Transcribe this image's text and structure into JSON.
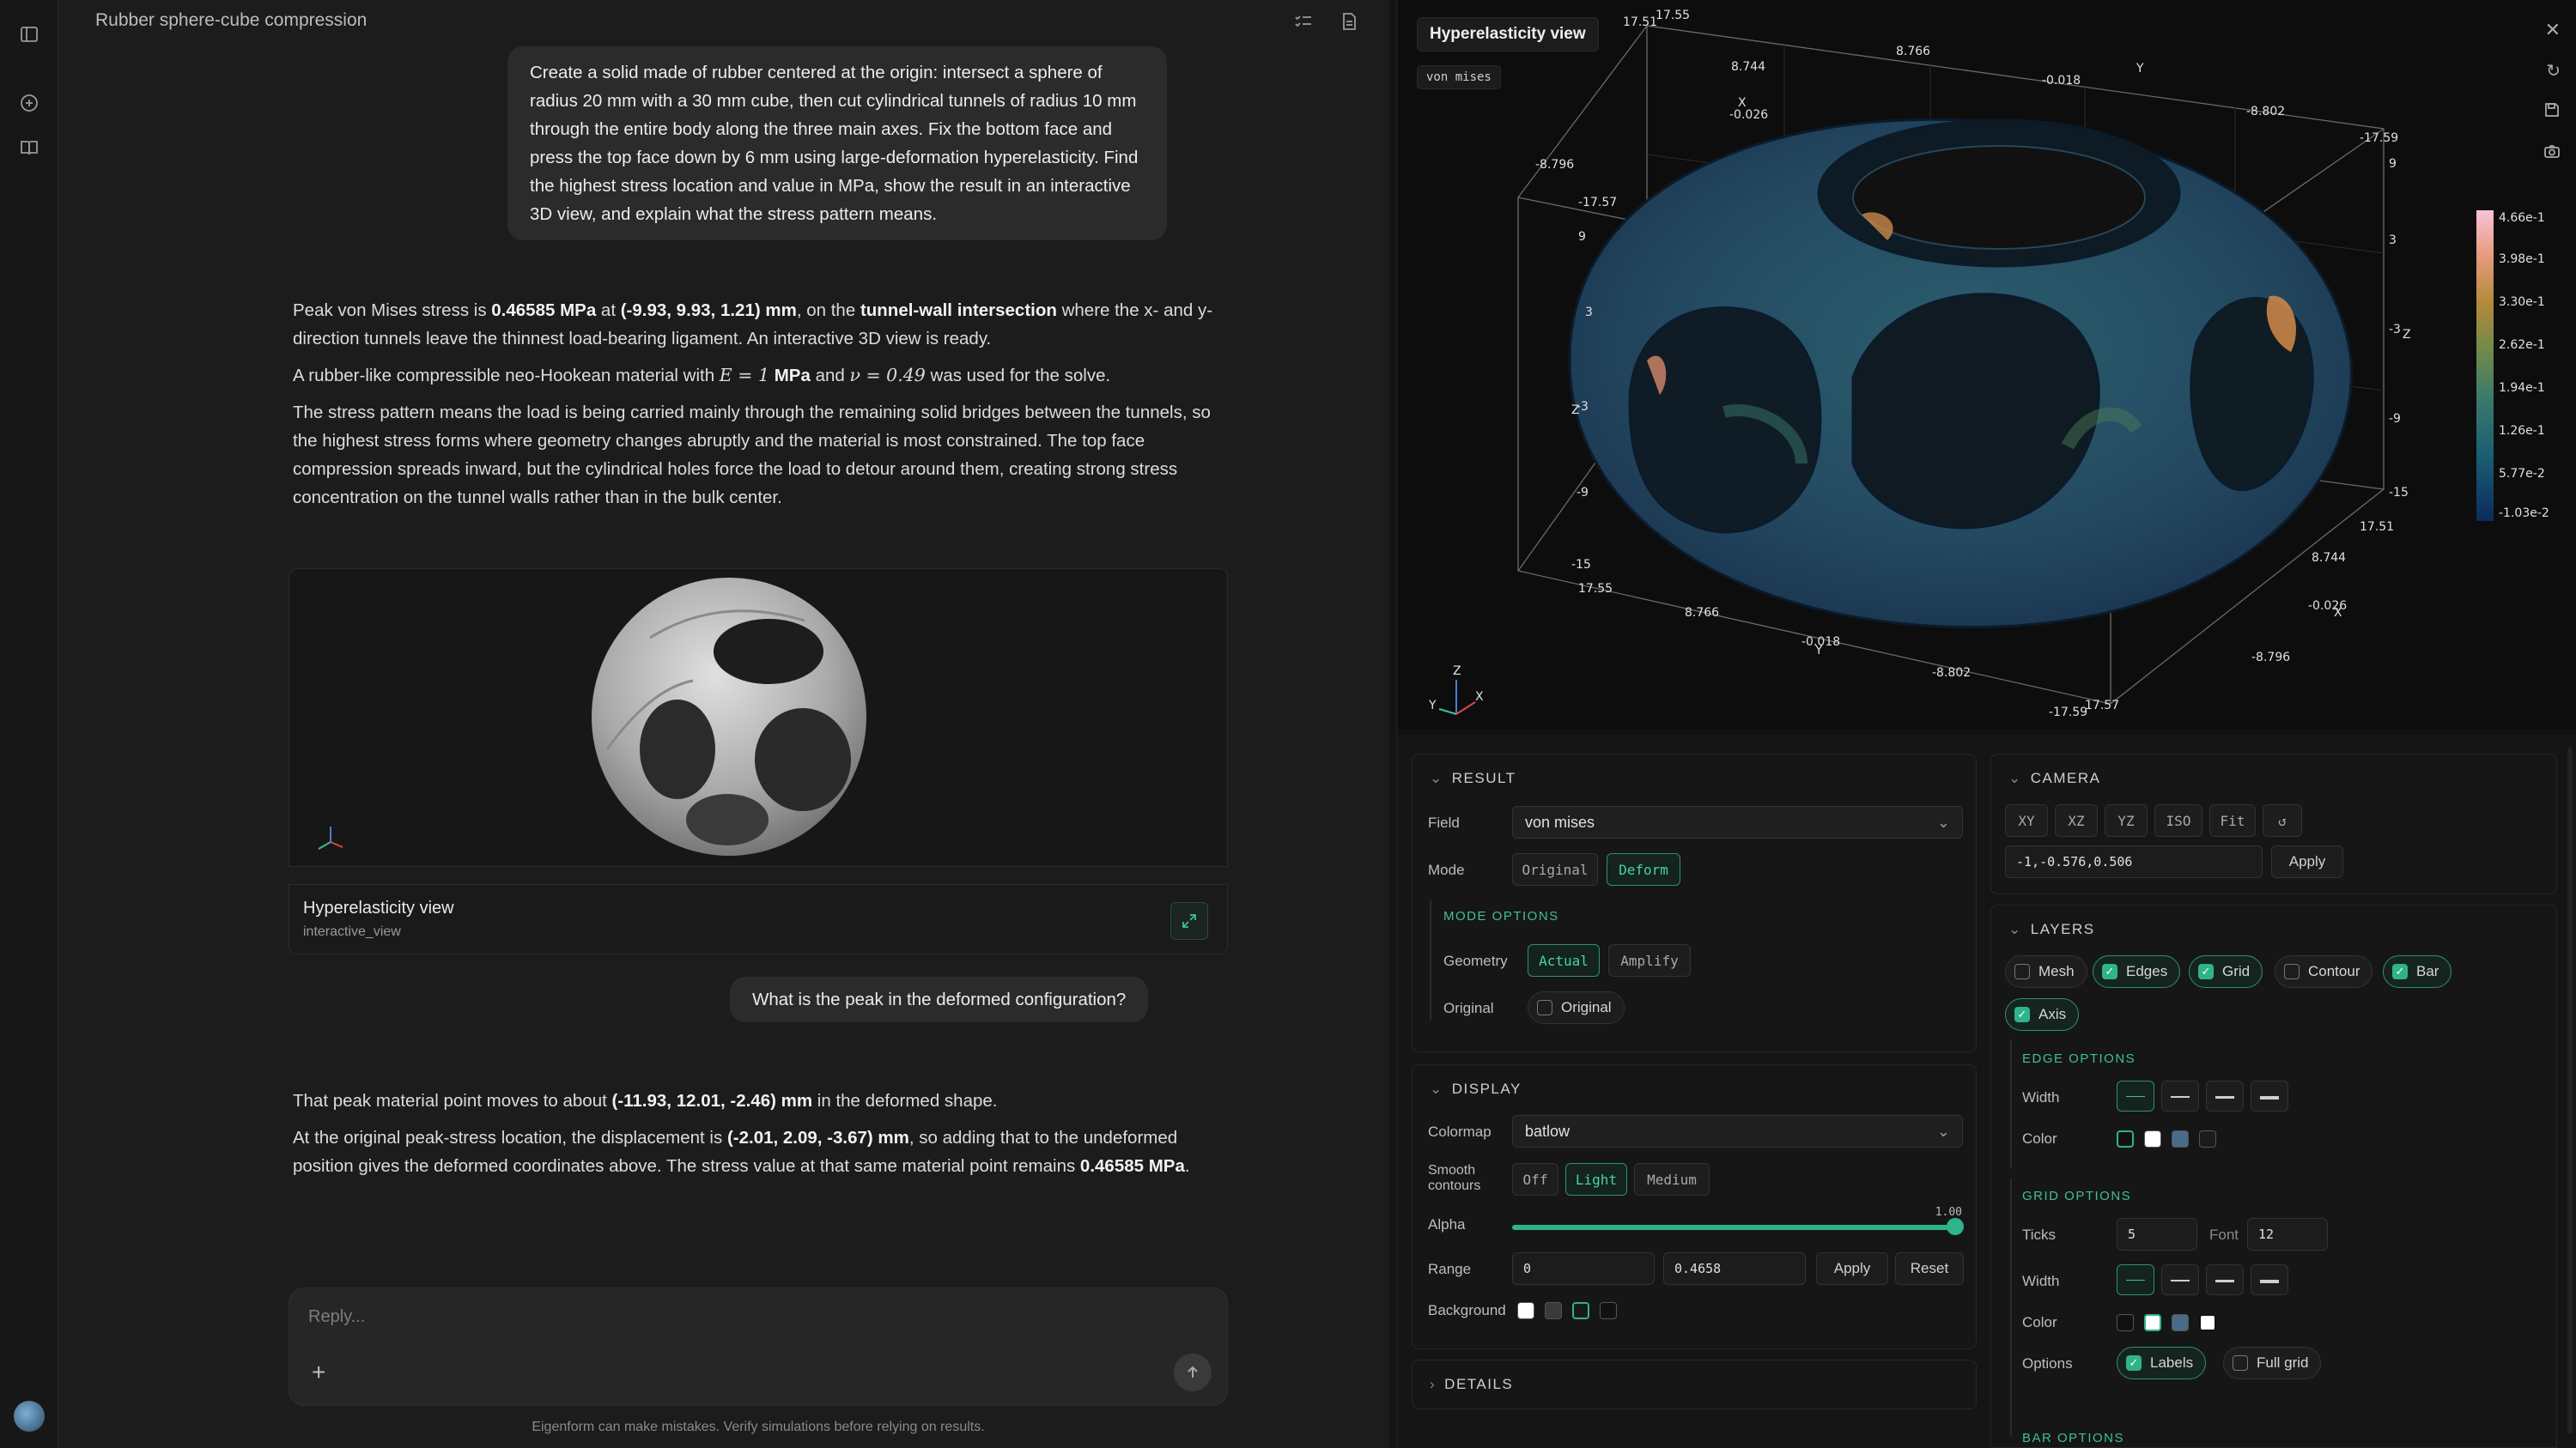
{
  "chat": {
    "title": "Rubber sphere-cube compression",
    "user_prompt": "Create a solid made of rubber centered at the origin: intersect a sphere of radius 20 mm with a 30 mm cube, then cut cylindrical tunnels of radius 10 mm through the entire body along the three main axes. Fix the bottom face and press the top face down by 6 mm using large-deformation hyperelasticity. Find the highest stress location and value in MPa, show the result in an interactive 3D view, and explain what the stress pattern means.",
    "answer1": {
      "p1_a": "Peak von Mises stress is ",
      "p1_b": "0.46585 MPa",
      "p1_c": " at ",
      "p1_d": "(-9.93, 9.93, 1.21) mm",
      "p1_e": ", on the ",
      "p1_f": "tunnel-wall intersection",
      "p1_g": " where the x- and y-direction tunnels leave the thinnest load-bearing ligament. An interactive 3D view is ready.",
      "p2_a": "A rubber-like compressible neo-Hookean material with ",
      "p2_e": "E = 1",
      "p2_b": " MPa",
      "p2_c": " and ",
      "p2_nu": "ν = 0.49",
      "p2_d": " was used for the solve.",
      "p3": "The stress pattern means the load is being carried mainly through the remaining solid bridges between the tunnels, so the highest stress forms where geometry changes abruptly and the material is most constrained. The top face compression spreads inward, but the cylindrical holes force the load to detour around them, creating strong stress concentration on the tunnel walls rather than in the bulk center."
    },
    "preview_card": {
      "title": "Hyperelasticity view",
      "subtitle": "interactive_view"
    },
    "user_followup": "What is the peak in the deformed configuration?",
    "answer2": {
      "p1_a": "That peak material point moves to about ",
      "p1_b": "(-11.93, 12.01, -2.46) mm",
      "p1_c": " in the deformed shape.",
      "p2_a": "At the original peak-stress location, the displacement is ",
      "p2_b": "(-2.01, 2.09, -3.67) mm",
      "p2_c": ", so adding that to the undeformed position gives the deformed coordinates above. The stress value at that same material point remains ",
      "p2_d": "0.46585 MPa",
      "p2_e": "."
    },
    "reply_placeholder": "Reply...",
    "disclaimer": "Eigenform can make mistakes. Verify simulations before relying on results."
  },
  "viewer": {
    "title": "Hyperelasticity view",
    "field_tag": "von mises",
    "axis_labels": {
      "top": [
        "17.51",
        "17.55",
        "8.744",
        "8.766",
        "-0.018",
        "-8.802",
        "-17.59",
        "-0.026",
        "-8.796",
        "-17.57",
        "X",
        "Y"
      ],
      "right_ticks": [
        "9",
        "3",
        "-3",
        "-9",
        "-15"
      ],
      "left_ticks": [
        "9",
        "3",
        "-3",
        "-9",
        "-15"
      ],
      "bottom": [
        "17.55",
        "8.766",
        "-0.018",
        "-8.802",
        "-17.59",
        "17.57",
        "-8.796",
        "-0.026",
        "8.744",
        "17.51"
      ],
      "z": "Z",
      "y": "Y",
      "x": "X"
    },
    "colorbar": [
      "4.66e-1",
      "3.98e-1",
      "3.30e-1",
      "2.62e-1",
      "1.94e-1",
      "1.26e-1",
      "5.77e-2",
      "-1.03e-2"
    ]
  },
  "result": {
    "header": "RESULT",
    "field_label": "Field",
    "field_value": "von mises",
    "mode_label": "Mode",
    "mode_options": [
      "Original",
      "Deform"
    ],
    "mode_selected": "Deform",
    "mode_options_header": "MODE OPTIONS",
    "geometry_label": "Geometry",
    "geometry_options": [
      "Actual",
      "Amplify"
    ],
    "geometry_selected": "Actual",
    "original_label": "Original",
    "original_checkbox": "Original"
  },
  "display": {
    "header": "DISPLAY",
    "colormap_label": "Colormap",
    "colormap_value": "batlow",
    "smooth_label_1": "Smooth",
    "smooth_label_2": "contours",
    "smooth_options": [
      "Off",
      "Light",
      "Medium"
    ],
    "smooth_selected": "Light",
    "alpha_label": "Alpha",
    "alpha_value": "1.00",
    "range_label": "Range",
    "range_min": "0",
    "range_max": "0.4658",
    "apply": "Apply",
    "reset": "Reset",
    "background_label": "Background",
    "details_header": "DETAILS"
  },
  "camera": {
    "header": "CAMERA",
    "views": [
      "XY",
      "XZ",
      "YZ",
      "ISO",
      "Fit"
    ],
    "vector": "-1,-0.576,0.506",
    "apply": "Apply"
  },
  "layers": {
    "header": "LAYERS",
    "items": [
      {
        "label": "Mesh",
        "checked": false
      },
      {
        "label": "Edges",
        "checked": true
      },
      {
        "label": "Grid",
        "checked": true
      },
      {
        "label": "Contour",
        "checked": false
      },
      {
        "label": "Bar",
        "checked": true
      },
      {
        "label": "Axis",
        "checked": true
      }
    ],
    "edge_options_header": "EDGE OPTIONS",
    "width_label": "Width",
    "color_label": "Color",
    "grid_options_header": "GRID OPTIONS",
    "ticks_label": "Ticks",
    "ticks_value": "5",
    "font_label": "Font",
    "font_value": "12",
    "options_label": "Options",
    "labels_option": "Labels",
    "fullgrid_option": "Full grid",
    "bar_options_header": "BAR OPTIONS"
  },
  "colors": {
    "accent": "#2fb38a",
    "bg": "#1c1c1c"
  }
}
